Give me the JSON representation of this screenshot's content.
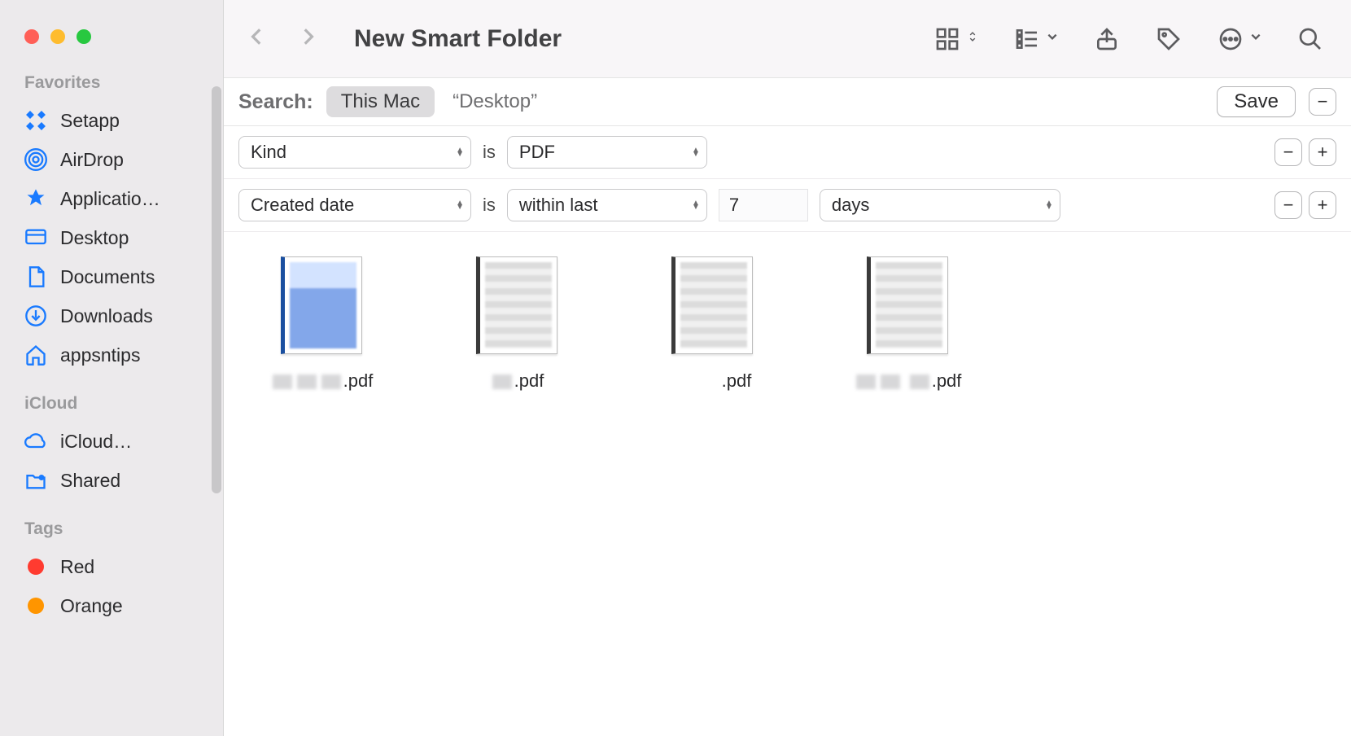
{
  "window": {
    "title": "New Smart Folder"
  },
  "sidebar": {
    "sections": [
      {
        "title": "Favorites",
        "items": [
          {
            "label": "Setapp"
          },
          {
            "label": "AirDrop"
          },
          {
            "label": "Applicatio…"
          },
          {
            "label": "Desktop"
          },
          {
            "label": "Documents"
          },
          {
            "label": "Downloads"
          },
          {
            "label": "appsntips"
          }
        ]
      },
      {
        "title": "iCloud",
        "items": [
          {
            "label": "iCloud…"
          },
          {
            "label": "Shared"
          }
        ]
      },
      {
        "title": "Tags",
        "items": [
          {
            "label": "Red",
            "color": "#ff3b30"
          },
          {
            "label": "Orange",
            "color": "#ff9500"
          }
        ]
      }
    ]
  },
  "search": {
    "label": "Search:",
    "scope_active": "This Mac",
    "scope_other": "“Desktop”",
    "save": "Save"
  },
  "rules": [
    {
      "field": "Kind",
      "op": "is",
      "value": "PDF"
    },
    {
      "field": "Created date",
      "op": "is",
      "value": "within last",
      "num": "7",
      "unit": "days"
    }
  ],
  "files": [
    {
      "ext": ".pdf",
      "selected": true,
      "two_line": false
    },
    {
      "ext": ".pdf",
      "selected": false,
      "two_line": true
    },
    {
      "ext": ".pdf",
      "selected": false,
      "two_line": true
    },
    {
      "ext": ".pdf",
      "selected": false,
      "two_line": false
    }
  ],
  "glyphs": {
    "minus": "−",
    "plus": "+"
  }
}
